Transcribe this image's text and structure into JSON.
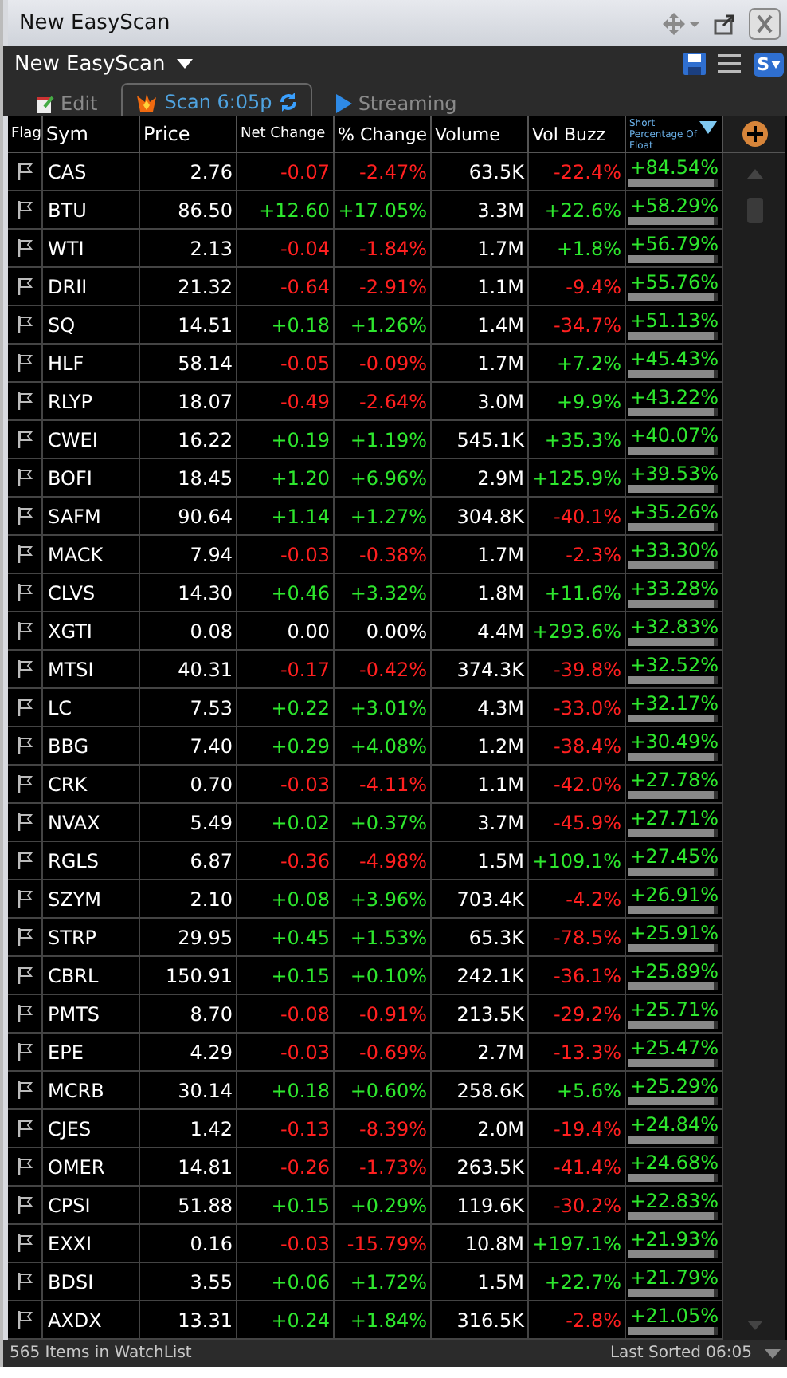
{
  "window": {
    "title": "New EasyScan"
  },
  "header": {
    "scan_name": "New EasyScan",
    "badge": "S"
  },
  "tabs": [
    {
      "label": "Edit",
      "kind": "edit",
      "selected": false
    },
    {
      "label": "Scan 6:05p",
      "kind": "scan",
      "selected": true
    },
    {
      "label": "Streaming",
      "kind": "stream",
      "selected": false
    }
  ],
  "table": {
    "columns": [
      "Flag",
      "Sym",
      "Price",
      "Net Change",
      "% Change",
      "Volume",
      "Vol Buzz",
      "Short Percentage Of Float"
    ],
    "rows": [
      {
        "sym": "CAS",
        "price": "2.76",
        "net": {
          "text": "-0.07",
          "color": "#ff2020"
        },
        "pct": {
          "text": "-2.47%",
          "color": "#ff2020"
        },
        "volume": "63.5K",
        "buzz": {
          "text": "-22.4%",
          "color": "#ff2020"
        },
        "short": "+84.54%"
      },
      {
        "sym": "BTU",
        "price": "86.50",
        "net": {
          "text": "+12.60",
          "color": "#2ee62e"
        },
        "pct": {
          "text": "+17.05%",
          "color": "#2ee62e"
        },
        "volume": "3.3M",
        "buzz": {
          "text": "+22.6%",
          "color": "#2ee62e"
        },
        "short": "+58.29%"
      },
      {
        "sym": "WTI",
        "price": "2.13",
        "net": {
          "text": "-0.04",
          "color": "#ff2020"
        },
        "pct": {
          "text": "-1.84%",
          "color": "#ff2020"
        },
        "volume": "1.7M",
        "buzz": {
          "text": "+1.8%",
          "color": "#2ee62e"
        },
        "short": "+56.79%"
      },
      {
        "sym": "DRII",
        "price": "21.32",
        "net": {
          "text": "-0.64",
          "color": "#ff2020"
        },
        "pct": {
          "text": "-2.91%",
          "color": "#ff2020"
        },
        "volume": "1.1M",
        "buzz": {
          "text": "-9.4%",
          "color": "#ff2020"
        },
        "short": "+55.76%"
      },
      {
        "sym": "SQ",
        "price": "14.51",
        "net": {
          "text": "+0.18",
          "color": "#2ee62e"
        },
        "pct": {
          "text": "+1.26%",
          "color": "#2ee62e"
        },
        "volume": "1.4M",
        "buzz": {
          "text": "-34.7%",
          "color": "#ff2020"
        },
        "short": "+51.13%"
      },
      {
        "sym": "HLF",
        "price": "58.14",
        "net": {
          "text": "-0.05",
          "color": "#ff2020"
        },
        "pct": {
          "text": "-0.09%",
          "color": "#ff2020"
        },
        "volume": "1.7M",
        "buzz": {
          "text": "+7.2%",
          "color": "#2ee62e"
        },
        "short": "+45.43%"
      },
      {
        "sym": "RLYP",
        "price": "18.07",
        "net": {
          "text": "-0.49",
          "color": "#ff2020"
        },
        "pct": {
          "text": "-2.64%",
          "color": "#ff2020"
        },
        "volume": "3.0M",
        "buzz": {
          "text": "+9.9%",
          "color": "#2ee62e"
        },
        "short": "+43.22%"
      },
      {
        "sym": "CWEI",
        "price": "16.22",
        "net": {
          "text": "+0.19",
          "color": "#2ee62e"
        },
        "pct": {
          "text": "+1.19%",
          "color": "#2ee62e"
        },
        "volume": "545.1K",
        "buzz": {
          "text": "+35.3%",
          "color": "#2ee62e"
        },
        "short": "+40.07%"
      },
      {
        "sym": "BOFI",
        "price": "18.45",
        "net": {
          "text": "+1.20",
          "color": "#2ee62e"
        },
        "pct": {
          "text": "+6.96%",
          "color": "#2ee62e"
        },
        "volume": "2.9M",
        "buzz": {
          "text": "+125.9%",
          "color": "#2ee62e"
        },
        "short": "+39.53%"
      },
      {
        "sym": "SAFM",
        "price": "90.64",
        "net": {
          "text": "+1.14",
          "color": "#2ee62e"
        },
        "pct": {
          "text": "+1.27%",
          "color": "#2ee62e"
        },
        "volume": "304.8K",
        "buzz": {
          "text": "-40.1%",
          "color": "#ff2020"
        },
        "short": "+35.26%"
      },
      {
        "sym": "MACK",
        "price": "7.94",
        "net": {
          "text": "-0.03",
          "color": "#ff2020"
        },
        "pct": {
          "text": "-0.38%",
          "color": "#ff2020"
        },
        "volume": "1.7M",
        "buzz": {
          "text": "-2.3%",
          "color": "#ff2020"
        },
        "short": "+33.30%"
      },
      {
        "sym": "CLVS",
        "price": "14.30",
        "net": {
          "text": "+0.46",
          "color": "#2ee62e"
        },
        "pct": {
          "text": "+3.32%",
          "color": "#2ee62e"
        },
        "volume": "1.8M",
        "buzz": {
          "text": "+11.6%",
          "color": "#2ee62e"
        },
        "short": "+33.28%"
      },
      {
        "sym": "XGTI",
        "price": "0.08",
        "net": {
          "text": "0.00",
          "color": "#ffffff"
        },
        "pct": {
          "text": "0.00%",
          "color": "#ffffff"
        },
        "volume": "4.4M",
        "buzz": {
          "text": "+293.6%",
          "color": "#2ee62e"
        },
        "short": "+32.83%"
      },
      {
        "sym": "MTSI",
        "price": "40.31",
        "net": {
          "text": "-0.17",
          "color": "#ff2020"
        },
        "pct": {
          "text": "-0.42%",
          "color": "#ff2020"
        },
        "volume": "374.3K",
        "buzz": {
          "text": "-39.8%",
          "color": "#ff2020"
        },
        "short": "+32.52%"
      },
      {
        "sym": "LC",
        "price": "7.53",
        "net": {
          "text": "+0.22",
          "color": "#2ee62e"
        },
        "pct": {
          "text": "+3.01%",
          "color": "#2ee62e"
        },
        "volume": "4.3M",
        "buzz": {
          "text": "-33.0%",
          "color": "#ff2020"
        },
        "short": "+32.17%"
      },
      {
        "sym": "BBG",
        "price": "7.40",
        "net": {
          "text": "+0.29",
          "color": "#2ee62e"
        },
        "pct": {
          "text": "+4.08%",
          "color": "#2ee62e"
        },
        "volume": "1.2M",
        "buzz": {
          "text": "-38.4%",
          "color": "#ff2020"
        },
        "short": "+30.49%"
      },
      {
        "sym": "CRK",
        "price": "0.70",
        "net": {
          "text": "-0.03",
          "color": "#ff2020"
        },
        "pct": {
          "text": "-4.11%",
          "color": "#ff2020"
        },
        "volume": "1.1M",
        "buzz": {
          "text": "-42.0%",
          "color": "#ff2020"
        },
        "short": "+27.78%"
      },
      {
        "sym": "NVAX",
        "price": "5.49",
        "net": {
          "text": "+0.02",
          "color": "#2ee62e"
        },
        "pct": {
          "text": "+0.37%",
          "color": "#2ee62e"
        },
        "volume": "3.7M",
        "buzz": {
          "text": "-45.9%",
          "color": "#ff2020"
        },
        "short": "+27.71%"
      },
      {
        "sym": "RGLS",
        "price": "6.87",
        "net": {
          "text": "-0.36",
          "color": "#ff2020"
        },
        "pct": {
          "text": "-4.98%",
          "color": "#ff2020"
        },
        "volume": "1.5M",
        "buzz": {
          "text": "+109.1%",
          "color": "#2ee62e"
        },
        "short": "+27.45%"
      },
      {
        "sym": "SZYM",
        "price": "2.10",
        "net": {
          "text": "+0.08",
          "color": "#2ee62e"
        },
        "pct": {
          "text": "+3.96%",
          "color": "#2ee62e"
        },
        "volume": "703.4K",
        "buzz": {
          "text": "-4.2%",
          "color": "#ff2020"
        },
        "short": "+26.91%"
      },
      {
        "sym": "STRP",
        "price": "29.95",
        "net": {
          "text": "+0.45",
          "color": "#2ee62e"
        },
        "pct": {
          "text": "+1.53%",
          "color": "#2ee62e"
        },
        "volume": "65.3K",
        "buzz": {
          "text": "-78.5%",
          "color": "#ff2020"
        },
        "short": "+25.91%"
      },
      {
        "sym": "CBRL",
        "price": "150.91",
        "net": {
          "text": "+0.15",
          "color": "#2ee62e"
        },
        "pct": {
          "text": "+0.10%",
          "color": "#2ee62e"
        },
        "volume": "242.1K",
        "buzz": {
          "text": "-36.1%",
          "color": "#ff2020"
        },
        "short": "+25.89%"
      },
      {
        "sym": "PMTS",
        "price": "8.70",
        "net": {
          "text": "-0.08",
          "color": "#ff2020"
        },
        "pct": {
          "text": "-0.91%",
          "color": "#ff2020"
        },
        "volume": "213.5K",
        "buzz": {
          "text": "-29.2%",
          "color": "#ff2020"
        },
        "short": "+25.71%"
      },
      {
        "sym": "EPE",
        "price": "4.29",
        "net": {
          "text": "-0.03",
          "color": "#ff2020"
        },
        "pct": {
          "text": "-0.69%",
          "color": "#ff2020"
        },
        "volume": "2.7M",
        "buzz": {
          "text": "-13.3%",
          "color": "#ff2020"
        },
        "short": "+25.47%"
      },
      {
        "sym": "MCRB",
        "price": "30.14",
        "net": {
          "text": "+0.18",
          "color": "#2ee62e"
        },
        "pct": {
          "text": "+0.60%",
          "color": "#2ee62e"
        },
        "volume": "258.6K",
        "buzz": {
          "text": "+5.6%",
          "color": "#2ee62e"
        },
        "short": "+25.29%"
      },
      {
        "sym": "CJES",
        "price": "1.42",
        "net": {
          "text": "-0.13",
          "color": "#ff2020"
        },
        "pct": {
          "text": "-8.39%",
          "color": "#ff2020"
        },
        "volume": "2.0M",
        "buzz": {
          "text": "-19.4%",
          "color": "#ff2020"
        },
        "short": "+24.84%"
      },
      {
        "sym": "OMER",
        "price": "14.81",
        "net": {
          "text": "-0.26",
          "color": "#ff2020"
        },
        "pct": {
          "text": "-1.73%",
          "color": "#ff2020"
        },
        "volume": "263.5K",
        "buzz": {
          "text": "-41.4%",
          "color": "#ff2020"
        },
        "short": "+24.68%"
      },
      {
        "sym": "CPSI",
        "price": "51.88",
        "net": {
          "text": "+0.15",
          "color": "#2ee62e"
        },
        "pct": {
          "text": "+0.29%",
          "color": "#2ee62e"
        },
        "volume": "119.6K",
        "buzz": {
          "text": "-30.2%",
          "color": "#ff2020"
        },
        "short": "+22.83%"
      },
      {
        "sym": "EXXI",
        "price": "0.16",
        "net": {
          "text": "-0.03",
          "color": "#ff2020"
        },
        "pct": {
          "text": "-15.79%",
          "color": "#ff2020"
        },
        "volume": "10.8M",
        "buzz": {
          "text": "+197.1%",
          "color": "#2ee62e"
        },
        "short": "+21.93%"
      },
      {
        "sym": "BDSI",
        "price": "3.55",
        "net": {
          "text": "+0.06",
          "color": "#2ee62e"
        },
        "pct": {
          "text": "+1.72%",
          "color": "#2ee62e"
        },
        "volume": "1.5M",
        "buzz": {
          "text": "+22.7%",
          "color": "#2ee62e"
        },
        "short": "+21.79%"
      },
      {
        "sym": "AXDX",
        "price": "13.31",
        "net": {
          "text": "+0.24",
          "color": "#2ee62e"
        },
        "pct": {
          "text": "+1.84%",
          "color": "#2ee62e"
        },
        "volume": "316.5K",
        "buzz": {
          "text": "-2.8%",
          "color": "#ff2020"
        },
        "short": "+21.05%"
      }
    ]
  },
  "status_bar": {
    "count": "565 Items in WatchList",
    "sorted": "Last Sorted 06:05"
  }
}
